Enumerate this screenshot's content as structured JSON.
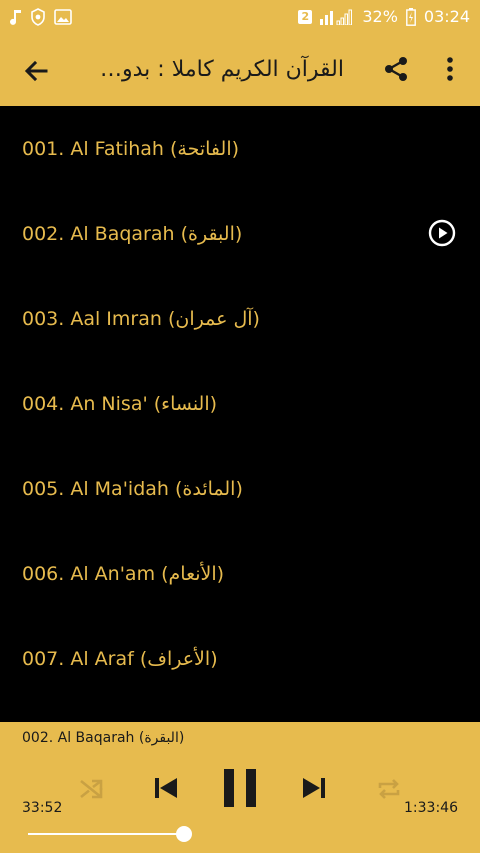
{
  "status_bar": {
    "sim_badge": "2",
    "battery_percent": "32%",
    "time": "03:24"
  },
  "app_bar": {
    "title": "القرآن الكريم كاملا : بدو…"
  },
  "tracks": [
    {
      "label": "001. Al Fatihah (الفاتحة)"
    },
    {
      "label": "002. Al Baqarah (البقرة)"
    },
    {
      "label": "003. Aal Imran (آل عمران)"
    },
    {
      "label": "004. An Nisa' (النساء)"
    },
    {
      "label": "005. Al Ma'idah (المائدة)"
    },
    {
      "label": "006. Al An'am (الأنعام)"
    },
    {
      "label": "007. Al Araf (الأعراف)"
    }
  ],
  "player": {
    "now_playing": "002. Al Baqarah (البقرة)",
    "elapsed": "33:52",
    "total": "1:33:46",
    "progress_fraction": 0.36
  },
  "colors": {
    "accent": "#E7BB4E",
    "background": "#000000",
    "icon_dark": "#1a1a1a"
  }
}
